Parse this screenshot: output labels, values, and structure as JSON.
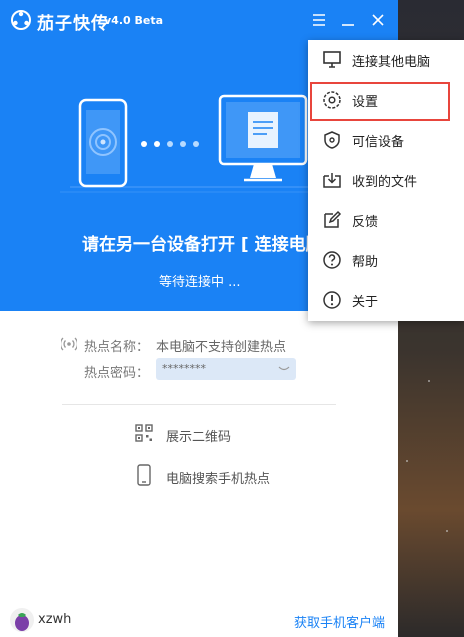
{
  "app": {
    "name": "茄子快传",
    "version": "v4.0 Beta"
  },
  "titlebar": {
    "menu_icon": "menu-icon",
    "minimize_icon": "minimize-icon",
    "close_icon": "close-icon"
  },
  "hero": {
    "instruction": "请在另一台设备打开 [ 连接电脑",
    "status": "等待连接中 ..."
  },
  "hotspot": {
    "name_label": "热点名称：",
    "name_value": "本电脑不支持创建热点",
    "password_label": "热点密码：",
    "password_value": "********"
  },
  "actions": {
    "qr_label": "展示二维码",
    "search_label": "电脑搜索手机热点"
  },
  "footer": {
    "username": "xzwh",
    "get_app": "获取手机客户端"
  },
  "menu": {
    "items": [
      {
        "label": "连接其他电脑",
        "icon": "monitor-icon"
      },
      {
        "label": "设置",
        "icon": "settings-icon"
      },
      {
        "label": "可信设备",
        "icon": "shield-icon"
      },
      {
        "label": "收到的文件",
        "icon": "download-folder-icon"
      },
      {
        "label": "反馈",
        "icon": "edit-icon"
      },
      {
        "label": "帮助",
        "icon": "help-icon"
      },
      {
        "label": "关于",
        "icon": "info-icon"
      }
    ],
    "highlighted_index": 1
  },
  "colors": {
    "brand": "#1a82f5",
    "highlight": "#e8453c"
  }
}
